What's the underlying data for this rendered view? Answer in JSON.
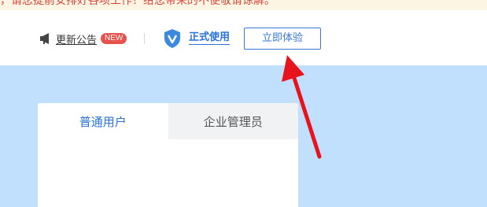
{
  "notice": {
    "text": "，请您提前安排好各项工作！给您带来的不便敬请谅解。"
  },
  "header": {
    "announcement_label": "更新公告",
    "new_badge": "NEW",
    "formal_use_label": "正式使用",
    "trial_button_label": "立即体验"
  },
  "login": {
    "tabs": [
      {
        "label": "普通用户",
        "active": true
      },
      {
        "label": "企业管理员",
        "active": false
      }
    ]
  },
  "colors": {
    "accent": "#2a73d9",
    "badge": "#e8504a",
    "hero_bg": "#c0e0fe",
    "notice_text": "#d9463a",
    "annotation_arrow": "#e8141c"
  },
  "icons": {
    "announcement": "megaphone-icon",
    "formal_use": "shield-icon"
  }
}
